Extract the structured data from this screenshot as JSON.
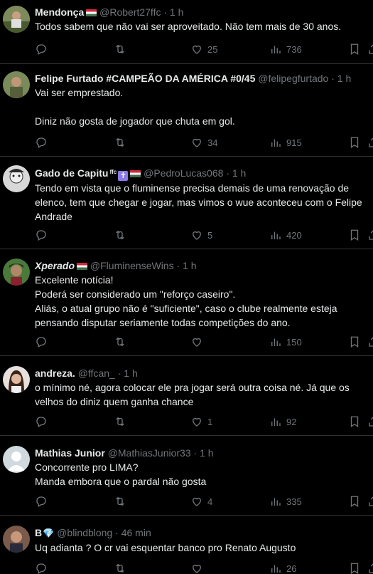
{
  "tweets": [
    {
      "name": "Mendonça",
      "flag": true,
      "handle": "@Robert27ffc",
      "time": "1 h",
      "text": "Todos sabem que não vai ser aproveitado. Não tem mais de 30 anos.",
      "replies": "",
      "retweets": "",
      "likes": "25",
      "views": "736",
      "avatar_color": "#5c6b4a"
    },
    {
      "name": "Felipe Furtado #CAMPEÃO DA AMÉRICA #0/45",
      "flag": false,
      "handle": "@felipegfurtado",
      "time": "1 h",
      "text": "Vai ser emprestado.\n\nDiniz não gosta de jogador que chuta em gol.",
      "replies": "",
      "retweets": "",
      "likes": "34",
      "views": "915",
      "avatar_color": "#6f7a4e"
    },
    {
      "name": "Gado de Capitu",
      "ffc": "ffc",
      "cross": "✝",
      "flag": true,
      "handle": "@PedroLucas068",
      "time": "1 h",
      "text": "Tendo em vista que o fluminense precisa demais de uma renovação de elenco, tem que chegar e jogar, mas vimos o wue aconteceu com o Felipe Andrade",
      "replies": "",
      "retweets": "",
      "likes": "5",
      "views": "420",
      "avatar_color": "#c9c9c9"
    },
    {
      "name": "Xperado",
      "flag": true,
      "handle": "@FluminenseWins",
      "time": "1 h",
      "text": "Excelente notícia!\nPoderá ser considerado um \"reforço caseiro\".\nAliás, o atual grupo não é \"suficiente\", caso o clube realmente esteja pensando disputar seriamente todas competições do ano.",
      "replies": "",
      "retweets": "",
      "likes": "",
      "views": "150",
      "avatar_color": "#3d6b3a"
    },
    {
      "name": "andreza.",
      "flag": false,
      "handle": "@ffcan_",
      "time": "1 h",
      "text": "o mínimo né, agora colocar ele pra jogar será outra coisa né. Já que os velhos do diniz quem ganha chance",
      "replies": "",
      "retweets": "",
      "likes": "1",
      "views": "92",
      "avatar_color": "#d9b8a8"
    },
    {
      "name": "Mathias Junior",
      "flag": false,
      "handle": "@MathiasJunior33",
      "time": "1 h",
      "text": "Concorrente pro LIMA?\nManda embora que o pardal não gosta",
      "replies": "",
      "retweets": "",
      "likes": "4",
      "views": "335",
      "avatar_color": "#cfd9de"
    },
    {
      "name": "B",
      "diamond": "💎",
      "flag": false,
      "handle": "@blindblong",
      "time": "46 min",
      "text": "Uq adianta ? O cr vai esquentar banco pro Renato Augusto",
      "replies": "",
      "retweets": "",
      "likes": "",
      "views": "26",
      "avatar_color": "#8a6a5a"
    }
  ],
  "separator": "·"
}
